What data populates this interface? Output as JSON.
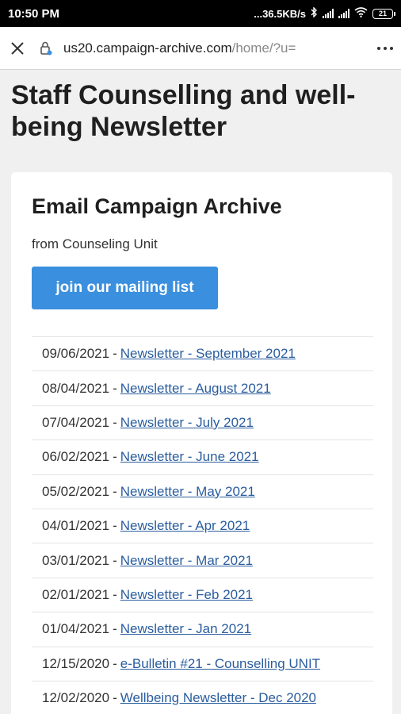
{
  "status": {
    "time": "10:50 PM",
    "net_speed": "...36.5KB/s",
    "battery": "21"
  },
  "browser": {
    "url_host": "us20.campaign-archive.com",
    "url_path": "/home/?u="
  },
  "page": {
    "title": "Staff Counselling and well-being Newsletter",
    "card_title": "Email Campaign Archive",
    "from_text": "from Counseling Unit",
    "join_label": "join our mailing list"
  },
  "archive": [
    {
      "date": "09/06/2021",
      "link": "Newsletter - September 2021"
    },
    {
      "date": "08/04/2021",
      "link": "Newsletter - August 2021"
    },
    {
      "date": "07/04/2021",
      "link": "Newsletter - July 2021"
    },
    {
      "date": "06/02/2021",
      "link": "Newsletter - June 2021"
    },
    {
      "date": "05/02/2021",
      "link": "Newsletter - May 2021"
    },
    {
      "date": "04/01/2021",
      "link": "Newsletter - Apr 2021"
    },
    {
      "date": "03/01/2021",
      "link": "Newsletter - Mar 2021"
    },
    {
      "date": "02/01/2021",
      "link": "Newsletter - Feb 2021"
    },
    {
      "date": "01/04/2021",
      "link": "Newsletter - Jan 2021"
    },
    {
      "date": "12/15/2020",
      "link": "e-Bulletin #21 - Counselling UNIT"
    },
    {
      "date": "12/02/2020",
      "link": "Wellbeing Newsletter - Dec 2020"
    }
  ],
  "icons": {
    "close": "close-icon",
    "lock": "lock-icon",
    "menu": "more-vert-icon",
    "bluetooth": "bluetooth-icon",
    "wifi": "wifi-icon"
  },
  "colors": {
    "button": "#3a8fde",
    "link": "#2a5d9f"
  }
}
